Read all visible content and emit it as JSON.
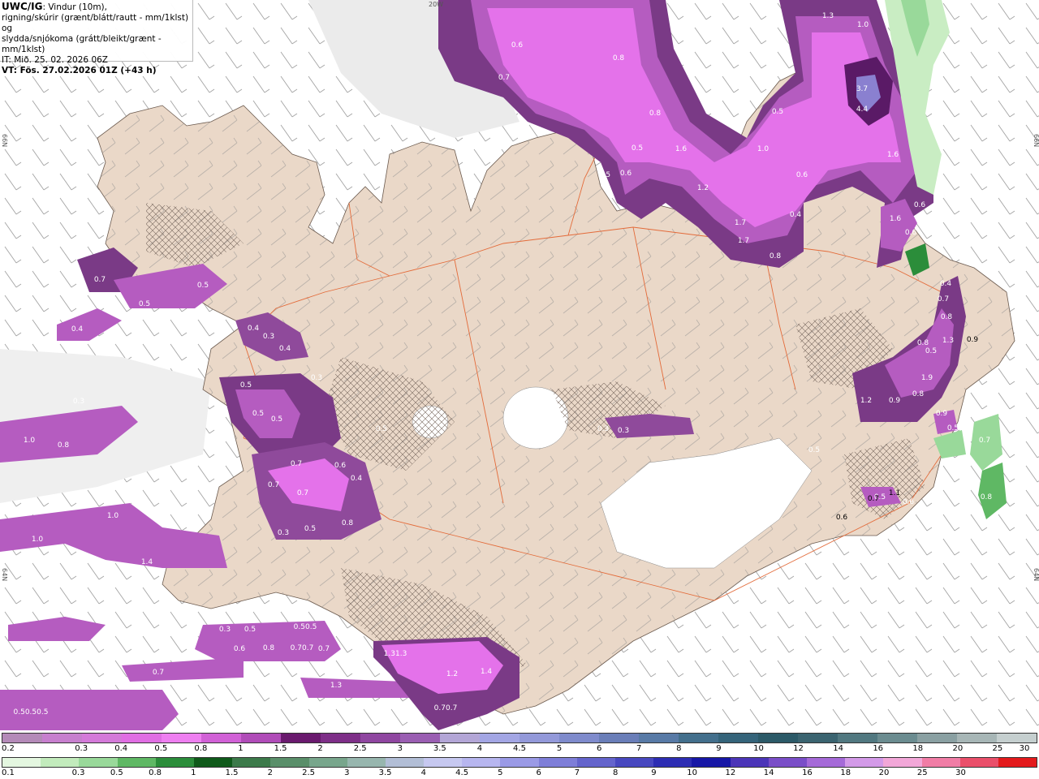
{
  "header": {
    "brand": "UWC/IG",
    "line1_rest": ": Vindur (10m),",
    "line2": "rigning/skúrir (grænt/blátt/rautt - mm/1klst) og",
    "line3": "slydda/snjókoma (grátt/bleikt/grænt - mm/1klst)",
    "line4": "IT: Mið. 25. 02. 2026 06Z",
    "line5": "VT: Fös. 27.02.2026 01Z (+43 h)"
  },
  "map": {
    "lat_labels": [
      "66N",
      "64N",
      "66N",
      "64N"
    ],
    "lon_label": "20W",
    "precip_labels": [
      {
        "t": "0.6",
        "c": "#8a3a9a"
      },
      {
        "t": "0.7",
        "c": "#8a3a9a"
      },
      {
        "t": "0.8",
        "c": "#8a3a9a"
      },
      {
        "t": "1.3",
        "c": "#8a3a9a"
      },
      {
        "t": "1.0",
        "c": "#8a3a9a"
      },
      {
        "t": "3.7",
        "c": "#8a3a9a"
      },
      {
        "t": "4.4",
        "c": "#8a3a9a"
      },
      {
        "t": "0.5",
        "c": "#8a3a9a"
      },
      {
        "t": "0.8",
        "c": "#8a3a9a"
      },
      {
        "t": "1.6",
        "c": "#8a3a9a"
      },
      {
        "t": "1.0",
        "c": "#8a3a9a"
      },
      {
        "t": "0.5",
        "c": "#8a3a9a"
      },
      {
        "t": "0.6",
        "c": "#8a3a9a"
      },
      {
        "t": "1.2",
        "c": "#8a3a9a"
      },
      {
        "t": "0.6",
        "c": "#8a3a9a"
      },
      {
        "t": "1.6",
        "c": "#8a3a9a"
      },
      {
        "t": "0.4",
        "c": "#8a3a9a"
      },
      {
        "t": "1.7",
        "c": "#8a3a9a"
      },
      {
        "t": "1.7",
        "c": "#8a3a9a"
      },
      {
        "t": "0.8",
        "c": "#8a3a9a"
      },
      {
        "t": "1.6",
        "c": "#8a3a9a"
      },
      {
        "t": "0.6",
        "c": "#8a3a9a"
      },
      {
        "t": "0.5",
        "c": "#8a3a9a"
      },
      {
        "t": "0.6",
        "c": "#8a3a9a"
      },
      {
        "t": "0.7",
        "c": "#8a3a9a"
      },
      {
        "t": "0.5",
        "c": "#8a3a9a"
      },
      {
        "t": "0.5",
        "c": "#8a3a9a"
      },
      {
        "t": "0.4",
        "c": "#8a3a9a"
      },
      {
        "t": "0.4",
        "c": "#8a3a9a"
      },
      {
        "t": "0.3",
        "c": "#8a3a9a"
      },
      {
        "t": "0.4",
        "c": "#8a3a9a"
      },
      {
        "t": "0.3",
        "c": "#8a3a9a"
      },
      {
        "t": "0.5",
        "c": "#8a3a9a"
      },
      {
        "t": "0.5",
        "c": "#8a3a9a"
      },
      {
        "t": "0.5",
        "c": "#8a3a9a"
      },
      {
        "t": "0.3",
        "c": "#8a3a9a"
      },
      {
        "t": "1.0",
        "c": "#8a3a9a"
      },
      {
        "t": "1.0",
        "c": "#8a3a9a"
      },
      {
        "t": "0.8",
        "c": "#8a3a9a"
      },
      {
        "t": "0.7",
        "c": "#8a3a9a"
      },
      {
        "t": "0.6",
        "c": "#8a3a9a"
      },
      {
        "t": "0.4",
        "c": "#8a3a9a"
      },
      {
        "t": "0.7",
        "c": "#8a3a9a"
      },
      {
        "t": "0.7",
        "c": "#8a3a9a"
      },
      {
        "t": "0.3",
        "c": "#8a3a9a"
      },
      {
        "t": "0.5",
        "c": "#8a3a9a"
      },
      {
        "t": "0.8",
        "c": "#8a3a9a"
      },
      {
        "t": "1.0",
        "c": "#8a3a9a"
      },
      {
        "t": "1.4",
        "c": "#8a3a9a"
      },
      {
        "t": "1.2",
        "c": "#8a3a9a"
      },
      {
        "t": "0.3",
        "c": "#8a3a9a"
      },
      {
        "t": "0.5",
        "c": "#8a3a9a"
      },
      {
        "t": "0.50.5",
        "c": "#8a3a9a"
      },
      {
        "t": "0.6",
        "c": "#8a3a9a"
      },
      {
        "t": "0.8",
        "c": "#8a3a9a"
      },
      {
        "t": "0.70.7",
        "c": "#8a3a9a"
      },
      {
        "t": "0.7",
        "c": "#8a3a9a"
      },
      {
        "t": "0.7",
        "c": "#8a3a9a"
      },
      {
        "t": "0.50.50.5",
        "c": "#8a3a9a"
      },
      {
        "t": "1.31.3",
        "c": "#8a3a9a"
      },
      {
        "t": "1.2",
        "c": "#8a3a9a"
      },
      {
        "t": "1.4",
        "c": "#8a3a9a"
      },
      {
        "t": "1.3",
        "c": "#8a3a9a"
      },
      {
        "t": "0.70.7",
        "c": "#8a3a9a"
      },
      {
        "t": "0.5",
        "c": "#8a3a9a"
      },
      {
        "t": "0.3",
        "c": "#8a3a9a"
      },
      {
        "t": "0.3",
        "c": "#8a3a9a"
      },
      {
        "t": "0.5",
        "c": "#8a3a9a"
      },
      {
        "t": "0.4",
        "c": "#8a3a9a"
      },
      {
        "t": "0.7",
        "c": "#8a3a9a"
      },
      {
        "t": "0.8",
        "c": "#8a3a9a"
      },
      {
        "t": "1.3",
        "c": "#8a3a9a"
      },
      {
        "t": "0.8",
        "c": "#8a3a9a"
      },
      {
        "t": "0.5",
        "c": "#8a3a9a"
      },
      {
        "t": "1.9",
        "c": "#8a3a9a"
      },
      {
        "t": "0.8",
        "c": "#8a3a9a"
      },
      {
        "t": "1.2",
        "c": "#8a3a9a"
      },
      {
        "t": "0.9",
        "c": "#8a3a9a"
      },
      {
        "t": "0.5",
        "c": "#8a3a9a"
      },
      {
        "t": "0.9",
        "c": "#8a3a9a"
      },
      {
        "t": "0.5",
        "c": "#8a3a9a"
      },
      {
        "t": "0.6",
        "c": "#8a3a9a"
      },
      {
        "t": "0.7",
        "c": "#8a3a9a"
      },
      {
        "t": "0.8",
        "c": "#8a3a9a"
      },
      {
        "t": "0.9",
        "c": "#2e7d3a"
      },
      {
        "t": "1.1",
        "c": "#2e7d3a"
      },
      {
        "t": "0.6",
        "c": "#2e7d3a"
      },
      {
        "t": "0.7",
        "c": "#2e7d3a"
      },
      {
        "t": "0.6",
        "c": "#2e7d3a"
      },
      {
        "t": "0.6",
        "c": "#2e7d3a"
      }
    ]
  },
  "legend": {
    "snow": {
      "colors": [
        "#b48ab8",
        "#c77fce",
        "#d47ad9",
        "#e06ee3",
        "#ee7ff0",
        "#d161d6",
        "#b04cb8",
        "#6a1a6e",
        "#7e2f88",
        "#8f46a0",
        "#9a5eb2",
        "#b3a6d6",
        "#a3a6e4",
        "#9399d9",
        "#7f8bcc",
        "#6a7eb8",
        "#587aa6",
        "#436f8c",
        "#35647a",
        "#2c5a68",
        "#3b6470",
        "#517880",
        "#6b8c90",
        "#8aa0a2",
        "#a7b6b6",
        "#c5cfcf"
      ],
      "labels": [
        "0.2",
        "0.3",
        "0.4",
        "0.5",
        "0.8",
        "1",
        "1.5",
        "2",
        "2.5",
        "3",
        "3.5",
        "4",
        "4.5",
        "5",
        "6",
        "7",
        "8",
        "9",
        "10",
        "12",
        "14",
        "16",
        "18",
        "20",
        "25",
        "30"
      ]
    },
    "rain": {
      "colors": [
        "#e4f7e0",
        "#c2ebbc",
        "#99d99a",
        "#5fb864",
        "#2b8d3a",
        "#0f5a1a",
        "#3c7a4a",
        "#5a8f6a",
        "#78a68c",
        "#97b6ae",
        "#b2bed6",
        "#c6c8f0",
        "#b7b6ef",
        "#9a9ae6",
        "#7e7ed8",
        "#6464cc",
        "#4848c0",
        "#2d2db3",
        "#1717a6",
        "#4b35b8",
        "#7a4ec8",
        "#a56ad8",
        "#d39ae8",
        "#f2a7d8",
        "#f17da6",
        "#ea4f6a",
        "#e31a1c"
      ],
      "labels": [
        "0.1",
        "0.3",
        "0.5",
        "0.8",
        "1",
        "1.5",
        "2",
        "2.5",
        "3",
        "3.5",
        "4",
        "4.5",
        "5",
        "6",
        "7",
        "8",
        "9",
        "10",
        "12",
        "14",
        "16",
        "18",
        "20",
        "25",
        "30"
      ]
    }
  }
}
